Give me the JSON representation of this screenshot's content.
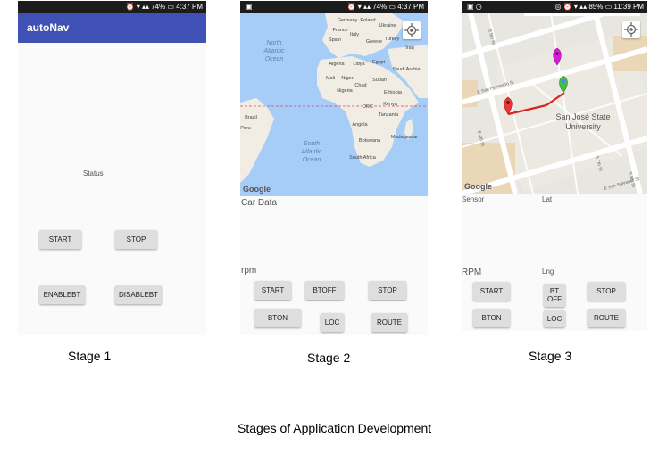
{
  "stage1": {
    "status_bar": {
      "right": "⏰ ▾ ▴▴ 74% ▭ 4:37 PM"
    },
    "app_title": "autoNav",
    "status_label": "Status",
    "buttons": {
      "start": "START",
      "stop": "STOP",
      "enablebt": "ENABLEBT",
      "disablebt": "DISABLEBT"
    },
    "caption": "Stage 1"
  },
  "stage2": {
    "status_bar": {
      "left": "▣",
      "right": "⏰ ▾ ▴▴ 74% ▭ 4:37 PM"
    },
    "map_labels": {
      "north_atlantic": "North Atlantic Ocean",
      "south_atlantic": "South Atlantic Ocean",
      "germany": "Germany",
      "poland": "Poland",
      "ukraine": "Ukraine",
      "france": "France",
      "italy": "Italy",
      "turkey": "Turkey",
      "spain": "Spain",
      "greece": "Greece",
      "iraq": "Iraq",
      "algeria": "Algeria",
      "libya": "Libya",
      "egypt": "Egypt",
      "saudi_arabia": "Saudi Arabia",
      "mali": "Mali",
      "niger": "Niger",
      "chad": "Chad",
      "sudan": "Sudan",
      "nigeria": "Nigeria",
      "ethiopia": "Ethiopia",
      "kenya": "Kenya",
      "tanzania": "Tanzania",
      "drc": "DRC",
      "angola": "Angola",
      "brazil": "Brazil",
      "peru": "Peru",
      "botswana": "Botswana",
      "madagascar": "Madagascar",
      "south_africa": "South Africa",
      "google": "Google"
    },
    "car_data_label": "Car Data",
    "rpm_label": "rpm",
    "buttons": {
      "start": "START",
      "btoff": "BTOFF",
      "stop": "STOP",
      "bton": "BTON",
      "loc": "LOC",
      "route": "ROUTE"
    },
    "caption": "Stage 2"
  },
  "stage3": {
    "status_bar": {
      "left": "▣ ◷",
      "right": "◎ ⏰ ▾ ▴▴ 85% ▭ 11:39 PM"
    },
    "map_labels": {
      "university": "San José State University",
      "e_san_fernando": "E San Fernando St",
      "e_san_salvador": "E San Salvador St",
      "s_5th": "S 5th St",
      "s_4th": "S 4th St",
      "s_9th": "S 9th St",
      "s_7th": "S 7th St",
      "google": "Google"
    },
    "sensor_label": "Sensor",
    "lat_label": "Lat",
    "rpm_label": "RPM",
    "lng_label": "Lng",
    "buttons": {
      "start": "START",
      "bt_off": "BT OFF",
      "stop": "STOP",
      "bton": "BTON",
      "loc": "LOC",
      "route": "ROUTE"
    },
    "caption": "Stage 3"
  },
  "figure_caption": "Stages of Application Development",
  "colors": {
    "app_bar": "#3f51b5",
    "ocean": "#a6cdf7",
    "land": "#f1ede4",
    "route": "#d6261e",
    "pin_red": "#e53935",
    "pin_magenta": "#d81bd8",
    "pin_green": "#43c043"
  }
}
